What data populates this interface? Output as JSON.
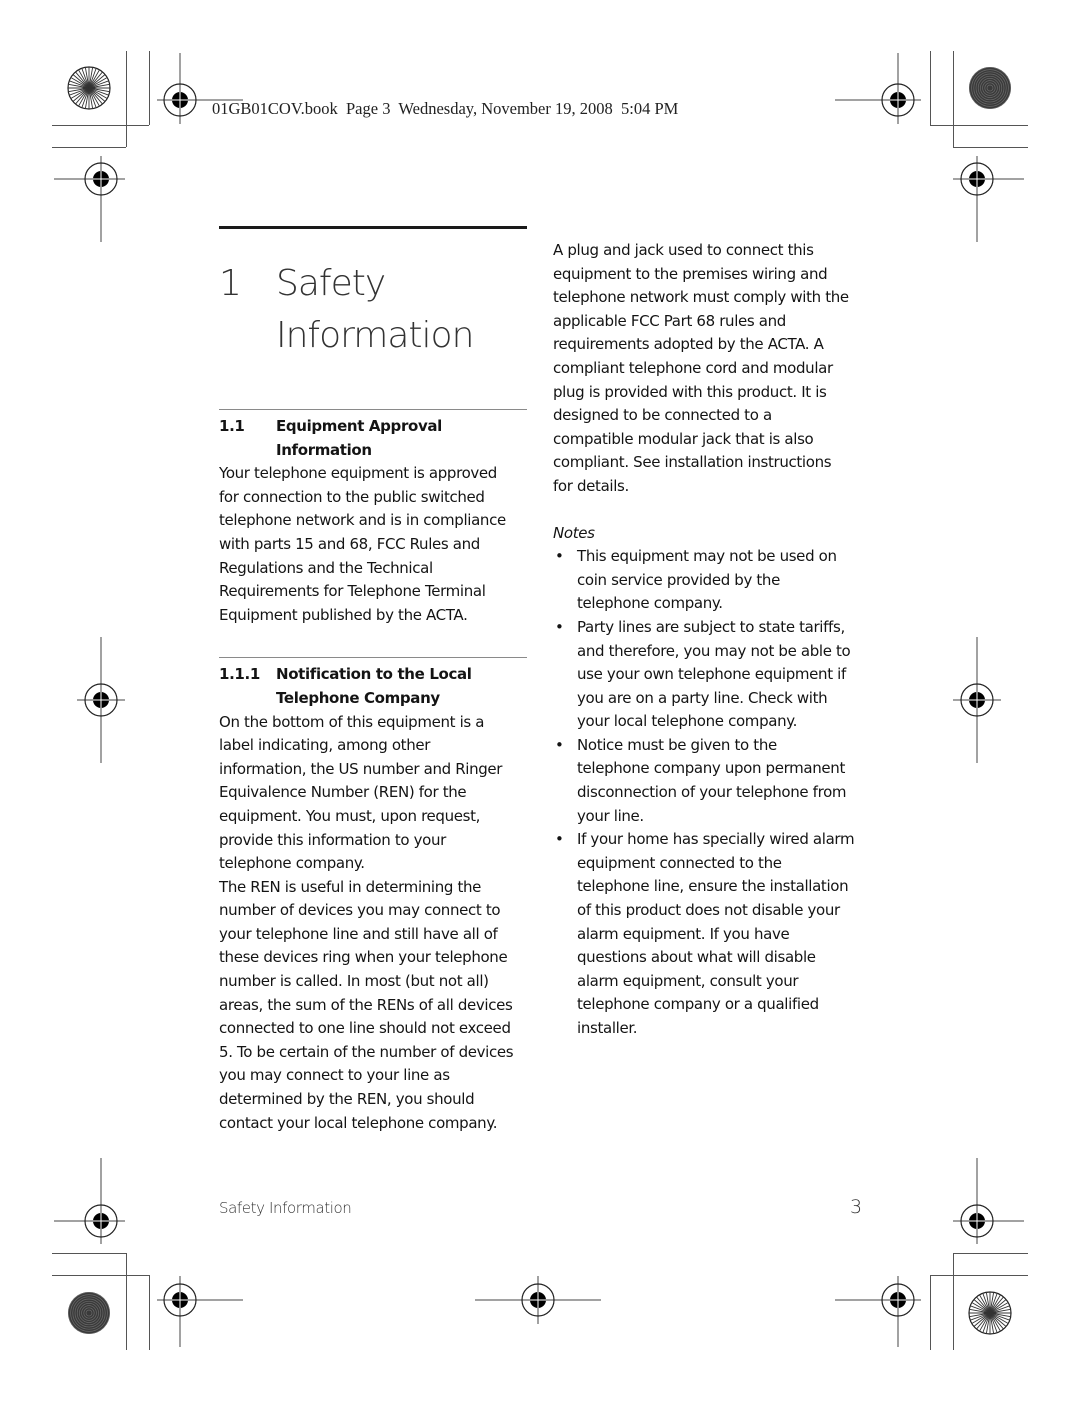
{
  "slug": "01GB01COV.book  Page 3  Wednesday, November 19, 2008  5:04 PM",
  "chapter": {
    "number": "1",
    "title_line1": "Safety",
    "title_line2": "Information"
  },
  "section": {
    "number": "1.1",
    "title_line1": "Equipment Approval",
    "title_line2": "Information",
    "lines": [
      "Your telephone equipment is approved",
      "for connection to the public switched",
      "telephone network and is in compliance",
      "with parts 15 and 68, FCC Rules and",
      "Regulations and the Technical",
      "Requirements for Telephone Terminal",
      "Equipment published by the ACTA."
    ]
  },
  "subsection": {
    "number": "1.1.1",
    "title_line1": "Notification to the Local",
    "title_line2": "Telephone Company",
    "lines1": [
      "On the bottom of this equipment is a",
      "label indicating, among other",
      "information, the US number and Ringer",
      "Equivalence Number (REN) for the",
      "equipment. You must, upon request,",
      "provide this information to your",
      "telephone company."
    ],
    "lines2": [
      "The REN is useful in determining the",
      "number of devices you may connect to",
      "your telephone line and still have all of",
      "these devices ring when your telephone",
      "number is called. In most (but not all)",
      "areas, the sum of the RENs of all devices",
      "connected to one line should not exceed",
      "5. To be certain of the number of devices",
      "you may connect to your line as",
      "determined by the REN, you should",
      "contact your local telephone company."
    ]
  },
  "right": {
    "lines": [
      "A plug and jack used to connect this",
      "equipment to the premises wiring and",
      "telephone network must comply with the",
      "applicable FCC Part 68 rules and",
      "requirements adopted by the ACTA. A",
      "compliant telephone cord and modular",
      "plug is provided with this product. It is",
      "designed to be connected to a",
      "compatible modular jack that is also",
      "compliant. See installation instructions",
      "for details."
    ],
    "notes_label": "Notes",
    "bullet_glyph": "•",
    "notes": [
      [
        "This equipment may not be used on",
        "coin service provided by the",
        "telephone company."
      ],
      [
        "Party lines are subject to state tariffs,",
        "and therefore, you may not be able to",
        "use your own telephone equipment if",
        "you are on a party line. Check with",
        "your local telephone company."
      ],
      [
        "Notice must be given to the",
        "telephone company upon permanent",
        "disconnection of your telephone from",
        "your line."
      ],
      [
        "If your home has specially wired alarm",
        "equipment connected to the",
        "telephone line, ensure the installation",
        "of this product does not disable your",
        "alarm equipment. If you have",
        "questions about what will disable",
        "alarm equipment, consult your",
        "telephone company or a qualified",
        "installer."
      ]
    ]
  },
  "footer": {
    "section_name": "Safety Information",
    "page_number": "3"
  },
  "marks": {
    "registration_icon": "registration-target-icon",
    "color_bar_icons": [
      "starburst-icon",
      "dark-concentric-icon"
    ]
  }
}
